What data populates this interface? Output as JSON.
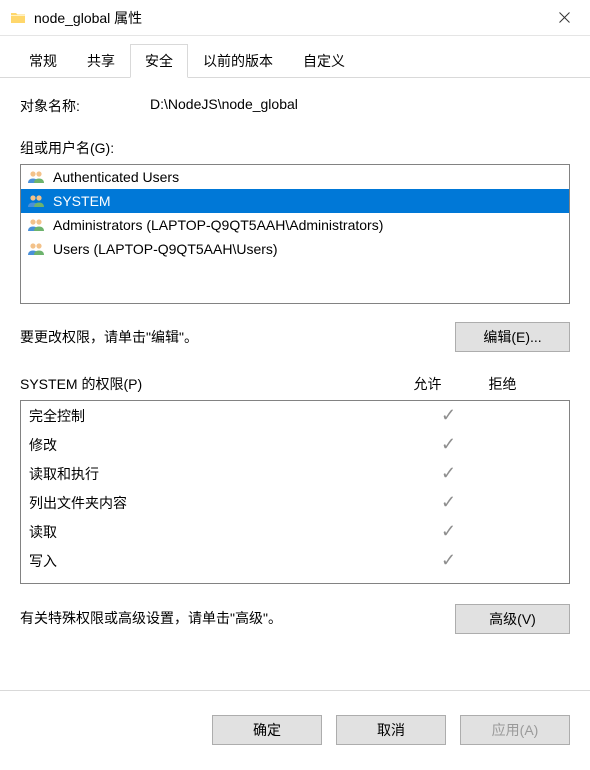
{
  "titlebar": {
    "title": "node_global 属性"
  },
  "tabs": [
    {
      "label": "常规"
    },
    {
      "label": "共享"
    },
    {
      "label": "安全"
    },
    {
      "label": "以前的版本"
    },
    {
      "label": "自定义"
    }
  ],
  "active_tab_index": 2,
  "content": {
    "object_label": "对象名称:",
    "object_value": "D:\\NodeJS\\node_global",
    "group_label": "组或用户名(G):",
    "users": [
      {
        "name": "Authenticated Users",
        "selected": false
      },
      {
        "name": "SYSTEM",
        "selected": true
      },
      {
        "name": "Administrators (LAPTOP-Q9QT5AAH\\Administrators)",
        "selected": false
      },
      {
        "name": "Users (LAPTOP-Q9QT5AAH\\Users)",
        "selected": false
      }
    ],
    "edit_hint": "要更改权限，请单击\"编辑\"。",
    "edit_button": "编辑(E)...",
    "perm_header": {
      "name": "SYSTEM 的权限(P)",
      "allow": "允许",
      "deny": "拒绝"
    },
    "permissions": [
      {
        "name": "完全控制",
        "allow": true,
        "deny": false
      },
      {
        "name": "修改",
        "allow": true,
        "deny": false
      },
      {
        "name": "读取和执行",
        "allow": true,
        "deny": false
      },
      {
        "name": "列出文件夹内容",
        "allow": true,
        "deny": false
      },
      {
        "name": "读取",
        "allow": true,
        "deny": false
      },
      {
        "name": "写入",
        "allow": true,
        "deny": false
      }
    ],
    "advanced_hint": "有关特殊权限或高级设置，请单击\"高级\"。",
    "advanced_button": "高级(V)"
  },
  "footer": {
    "ok": "确定",
    "cancel": "取消",
    "apply": "应用(A)"
  },
  "icons": {
    "allow_symbol": "✓"
  }
}
